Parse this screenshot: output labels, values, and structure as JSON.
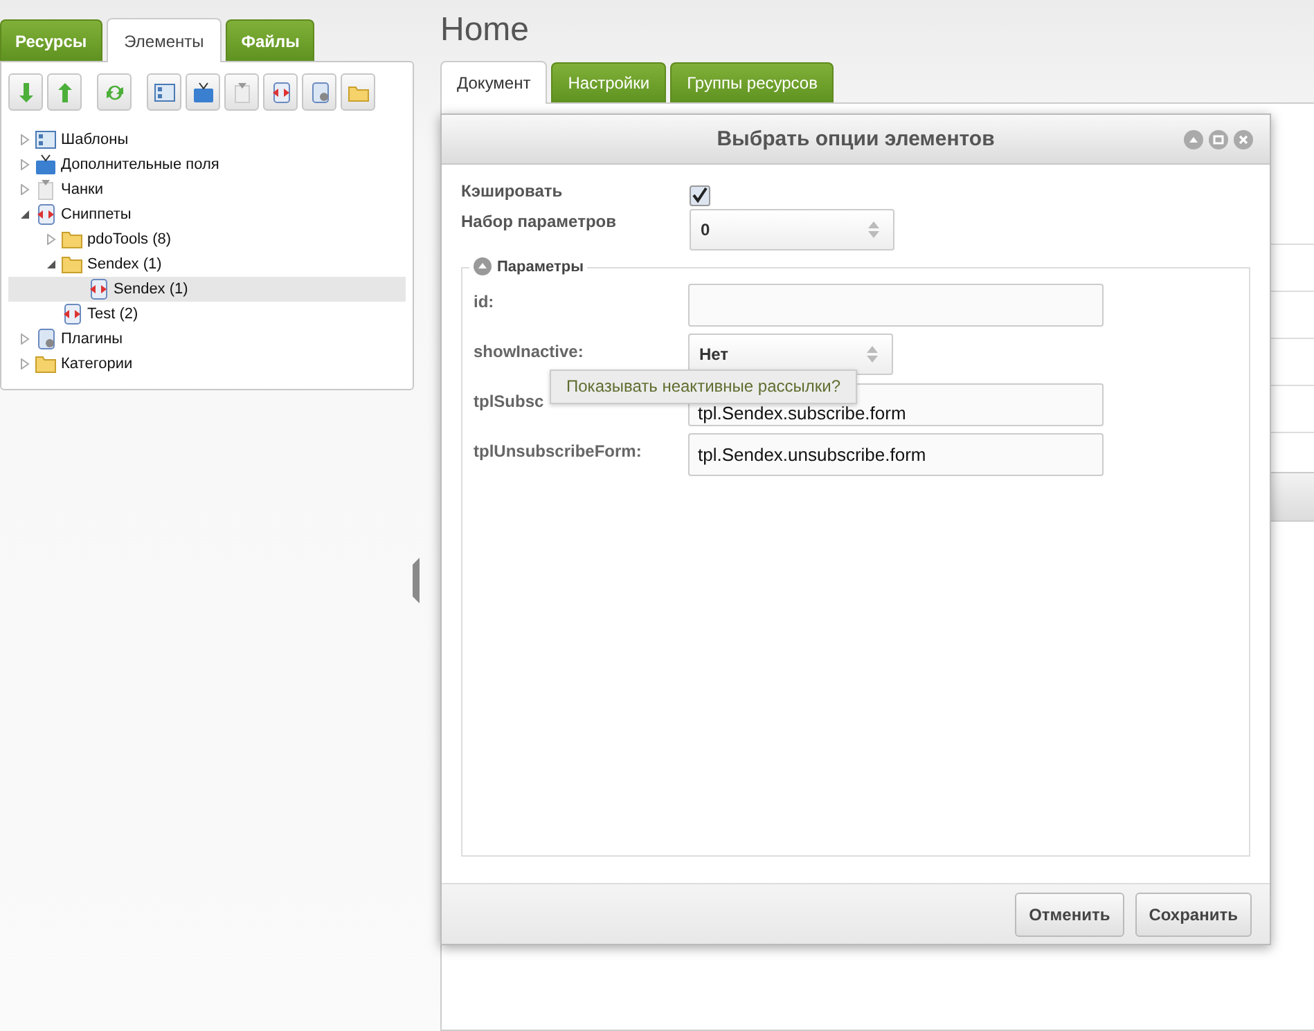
{
  "left_tabs": [
    {
      "label": "Ресурсы",
      "selected": false
    },
    {
      "label": "Элементы",
      "selected": true
    },
    {
      "label": "Файлы",
      "selected": false
    }
  ],
  "tree": [
    {
      "label": "Шаблоны",
      "kind": "template",
      "expanded": false,
      "selected": false
    },
    {
      "label": "Дополнительные поля",
      "kind": "tv",
      "expanded": false,
      "selected": false
    },
    {
      "label": "Чанки",
      "kind": "chunk",
      "expanded": false,
      "selected": false
    },
    {
      "label": "Сниппеты",
      "kind": "snippet",
      "expanded": true,
      "selected": false,
      "children": [
        {
          "label": "pdoTools (8)",
          "kind": "folder",
          "expanded": false,
          "selected": false
        },
        {
          "label": "Sendex (1)",
          "kind": "folder",
          "expanded": true,
          "selected": false,
          "children": [
            {
              "label": "Sendex (1)",
              "kind": "snippet",
              "selected": true
            }
          ]
        },
        {
          "label": "Test (2)",
          "kind": "snippet",
          "selected": false
        }
      ]
    },
    {
      "label": "Плагины",
      "kind": "plugin",
      "expanded": false,
      "selected": false
    },
    {
      "label": "Категории",
      "kind": "folder",
      "expanded": false,
      "selected": false
    }
  ],
  "page": {
    "title": "Home"
  },
  "tabs": [
    {
      "label": "Документ",
      "selected": true
    },
    {
      "label": "Настройки",
      "selected": false
    },
    {
      "label": "Группы ресурсов",
      "selected": false
    }
  ],
  "dialog": {
    "title": "Выбрать опции элементов",
    "cache": {
      "label": "Кэшировать",
      "checked": true
    },
    "property_set": {
      "label": "Набор параметров",
      "value": "0"
    },
    "fieldset": {
      "legend": "Параметры",
      "expanded": true,
      "fields": [
        {
          "label": "id:",
          "kind": "text"
        },
        {
          "label": "showInactive:",
          "kind": "select",
          "value": "Нет"
        },
        {
          "label": "tplSubsc",
          "kind": "text",
          "value": "tpl.Sendex.subscribe.form"
        },
        {
          "label": "tplUnsubscribeForm:",
          "kind": "text",
          "value": "tpl.Sendex.unsubscribe.form"
        }
      ]
    },
    "tooltip": "Показывать неактивные рассылки?",
    "buttons": [
      "Отменить",
      "Сохранить"
    ]
  }
}
